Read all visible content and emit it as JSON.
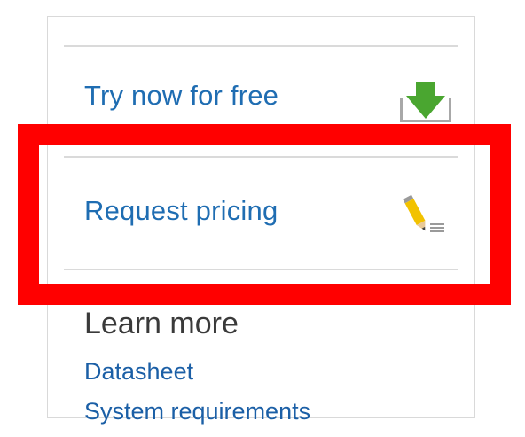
{
  "actions": {
    "try_free": {
      "label": "Try now for free",
      "icon": "download-arrow-icon",
      "icon_color": "#4aa630"
    },
    "request_pricing": {
      "label": "Request pricing",
      "icon": "pencil-document-icon",
      "icon_color": "#f0c000"
    }
  },
  "learn_more": {
    "heading": "Learn more",
    "links": [
      "Datasheet",
      "System requirements"
    ]
  },
  "highlight": {
    "color": "#ff0000"
  },
  "colors": {
    "link": "#1f6db2",
    "divider": "#dadada"
  }
}
